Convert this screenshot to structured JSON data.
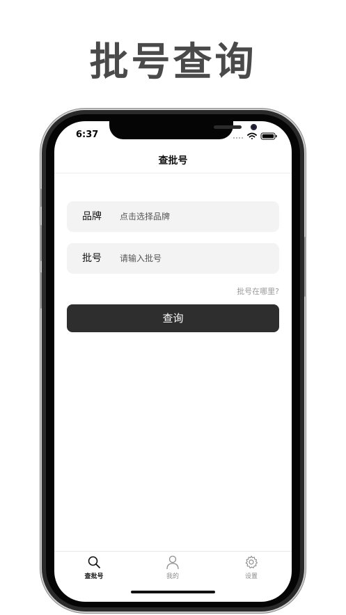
{
  "headline": "批号查询",
  "status_bar": {
    "time": "6:37"
  },
  "nav": {
    "title": "查批号"
  },
  "form": {
    "brand": {
      "label": "品牌",
      "placeholder": "点击选择品牌"
    },
    "batch": {
      "label": "批号",
      "placeholder": "请输入批号"
    },
    "hint_link": "批号在哪里?",
    "query_button": "查询"
  },
  "tabbar": {
    "items": [
      {
        "label": "查批号",
        "icon": "search-icon",
        "active": true
      },
      {
        "label": "我的",
        "icon": "person-icon",
        "active": false
      },
      {
        "label": "设置",
        "icon": "gear-icon",
        "active": false
      }
    ]
  },
  "colors": {
    "headline": "#4a4a4a",
    "button_bg": "#2e2e2e",
    "field_bg": "#f3f3f3"
  }
}
